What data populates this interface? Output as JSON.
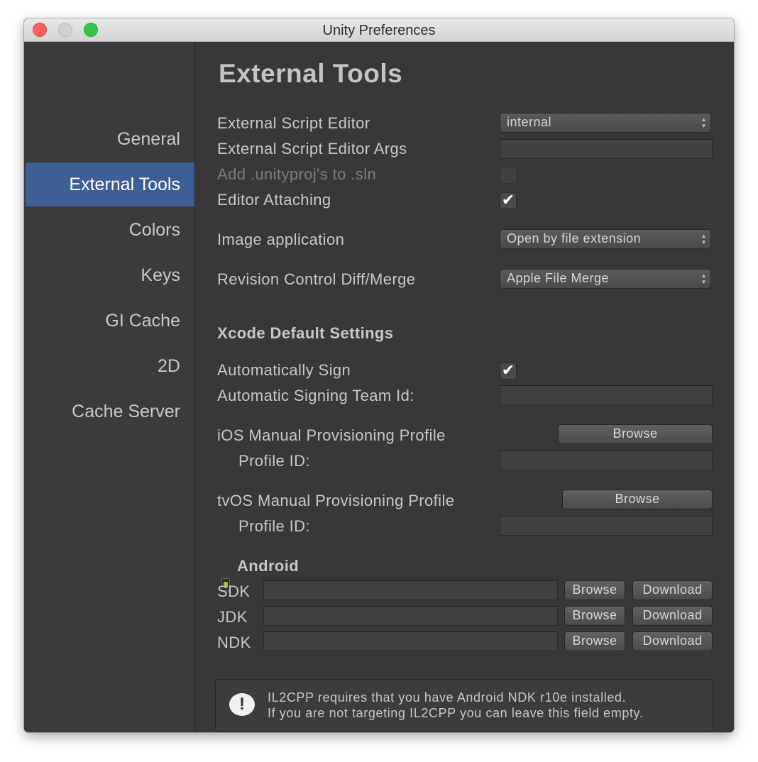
{
  "window": {
    "title": "Unity Preferences"
  },
  "sidebar": {
    "items": [
      {
        "label": "General"
      },
      {
        "label": "External Tools"
      },
      {
        "label": "Colors"
      },
      {
        "label": "Keys"
      },
      {
        "label": "GI Cache"
      },
      {
        "label": "2D"
      },
      {
        "label": "Cache Server"
      }
    ],
    "active": "External Tools"
  },
  "main": {
    "heading": "External Tools",
    "script_editor": {
      "label": "External Script Editor",
      "value": "internal"
    },
    "script_editor_args": {
      "label": "External Script Editor Args",
      "value": ""
    },
    "add_unityproj": {
      "label": "Add .unityproj's to .sln",
      "checked": false,
      "enabled": false
    },
    "editor_attaching": {
      "label": "Editor Attaching",
      "checked": true,
      "check_glyph": "✔"
    },
    "image_application": {
      "label": "Image application",
      "value": "Open by file extension"
    },
    "revision_control": {
      "label": "Revision Control Diff/Merge",
      "value": "Apple File Merge"
    },
    "xcode": {
      "heading": "Xcode Default Settings",
      "auto_sign": {
        "label": "Automatically Sign",
        "checked": true,
        "check_glyph": "✔"
      },
      "team_id": {
        "label": "Automatic Signing Team Id:",
        "value": ""
      },
      "ios_profile": {
        "label": "iOS Manual Provisioning Profile",
        "browse": "Browse",
        "profile_id_label": "Profile ID:",
        "profile_id_value": ""
      },
      "tvos_profile": {
        "label": "tvOS Manual Provisioning Profile",
        "browse": "Browse",
        "profile_id_label": "Profile ID:",
        "profile_id_value": ""
      }
    },
    "android": {
      "heading": "Android",
      "rows": [
        {
          "label": "SDK",
          "value": "",
          "browse": "Browse",
          "download": "Download"
        },
        {
          "label": "JDK",
          "value": "",
          "browse": "Browse",
          "download": "Download"
        },
        {
          "label": "NDK",
          "value": "",
          "browse": "Browse",
          "download": "Download"
        }
      ],
      "info": {
        "line1": "IL2CPP requires that you have Android NDK r10e installed.",
        "line2": "If you are not targeting IL2CPP you can leave this field empty."
      }
    }
  }
}
